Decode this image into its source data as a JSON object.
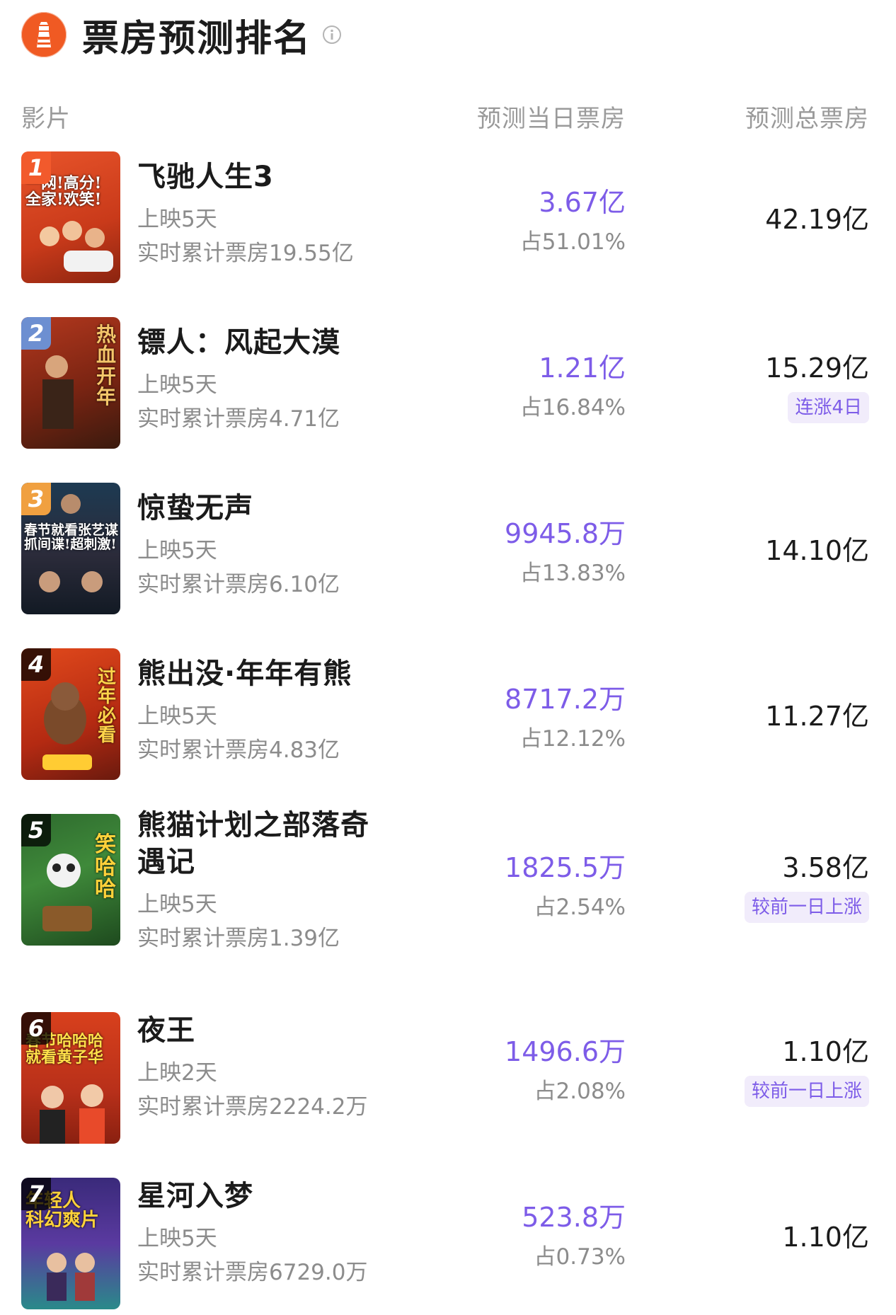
{
  "header": {
    "title": "票房预测排名",
    "logo_icon": "lighthouse-icon",
    "info_icon": "info-icon"
  },
  "columns": {
    "film": "影片",
    "daily": "预测当日票房",
    "total": "预测总票房"
  },
  "colors": {
    "accent": "#7d5ce8",
    "brand": "#f05a23",
    "badge_bg": "#f1ecfb"
  },
  "movies": [
    {
      "rank": "1",
      "name": "飞驰人生3",
      "days": "上映5天",
      "cumulative": "实时累计票房19.55亿",
      "daily": "3.67亿",
      "share": "占51.01%",
      "total": "42.19亿",
      "badge": "",
      "poster_text": "一网!高分!\n全家!欢笑!"
    },
    {
      "rank": "2",
      "name": "镖人：风起大漠",
      "days": "上映5天",
      "cumulative": "实时累计票房4.71亿",
      "daily": "1.21亿",
      "share": "占16.84%",
      "total": "15.29亿",
      "badge": "连涨4日",
      "poster_text": "热血开年"
    },
    {
      "rank": "3",
      "name": "惊蛰无声",
      "days": "上映5天",
      "cumulative": "实时累计票房6.10亿",
      "daily": "9945.8万",
      "share": "占13.83%",
      "total": "14.10亿",
      "badge": "",
      "poster_text": "春节就看张艺谋\n抓间谍!超刺激!"
    },
    {
      "rank": "4",
      "name": "熊出没·年年有熊",
      "days": "上映5天",
      "cumulative": "实时累计票房4.83亿",
      "daily": "8717.2万",
      "share": "占12.12%",
      "total": "11.27亿",
      "badge": "",
      "poster_text": "过年必看"
    },
    {
      "rank": "5",
      "name": "熊猫计划之部落奇遇记",
      "days": "上映5天",
      "cumulative": "实时累计票房1.39亿",
      "daily": "1825.5万",
      "share": "占2.54%",
      "total": "3.58亿",
      "badge": "较前一日上涨",
      "poster_text": "笑哈哈"
    },
    {
      "rank": "6",
      "name": "夜王",
      "days": "上映2天",
      "cumulative": "实时累计票房2224.2万",
      "daily": "1496.6万",
      "share": "占2.08%",
      "total": "1.10亿",
      "badge": "较前一日上涨",
      "poster_text": "春节哈哈哈\n就看黄子华"
    },
    {
      "rank": "7",
      "name": "星河入梦",
      "days": "上映5天",
      "cumulative": "实时累计票房6729.0万",
      "daily": "523.8万",
      "share": "占0.73%",
      "total": "1.10亿",
      "badge": "",
      "poster_text": "年轻人\n科幻爽片"
    }
  ]
}
